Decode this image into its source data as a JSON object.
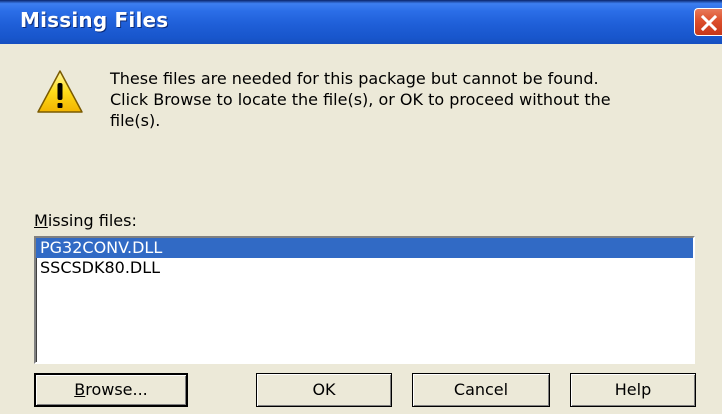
{
  "window": {
    "title": "Missing Files"
  },
  "message": {
    "lines": [
      "These files are needed for this package but cannot be found.",
      "Click Browse to locate the file(s), or OK to proceed without the",
      "file(s)."
    ]
  },
  "list": {
    "label_mnemonic": "M",
    "label_rest": "issing files:",
    "items": [
      {
        "label": "PG32CONV.DLL",
        "selected": true
      },
      {
        "label": "SSCSDK80.DLL",
        "selected": false
      }
    ]
  },
  "buttons": {
    "browse_mnemonic": "B",
    "browse_rest": "rowse...",
    "ok": "OK",
    "cancel": "Cancel",
    "help": "Help"
  },
  "icons": {
    "close": "close-icon",
    "warning": "warning-icon"
  },
  "colors": {
    "titlebar": "#1f5fd8",
    "selection": "#316ac5",
    "dialog_bg": "#ece9d8",
    "close_button": "#dc4f2c"
  }
}
